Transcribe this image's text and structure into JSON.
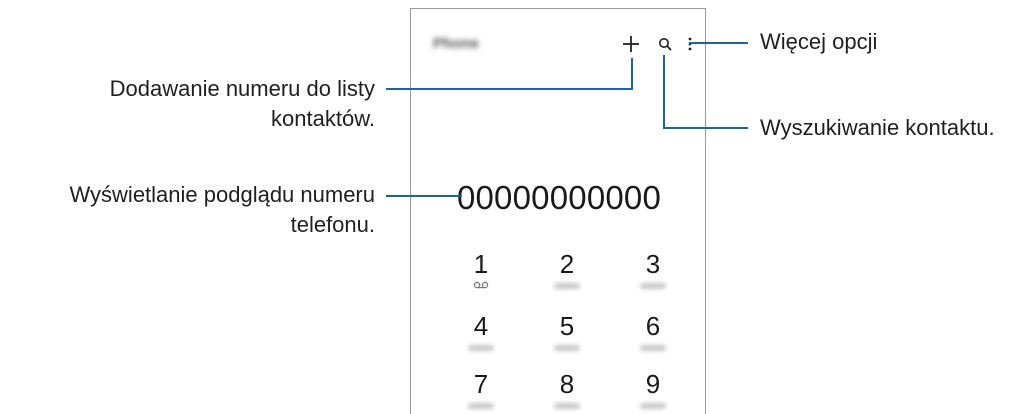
{
  "app": {
    "title": "Phone"
  },
  "dialer": {
    "number": "00000000000",
    "keys": [
      {
        "digit": "1",
        "sub": "voicemail-icon"
      },
      {
        "digit": "2",
        "sub": "ABC"
      },
      {
        "digit": "3",
        "sub": "DEF"
      },
      {
        "digit": "4",
        "sub": "GHI"
      },
      {
        "digit": "5",
        "sub": "JKL"
      },
      {
        "digit": "6",
        "sub": "MNO"
      },
      {
        "digit": "7",
        "sub": "PQRS"
      },
      {
        "digit": "8",
        "sub": "TUV"
      },
      {
        "digit": "9",
        "sub": "WXYZ"
      }
    ]
  },
  "toolbar": {
    "add_icon": "plus-icon",
    "search_icon": "search-icon",
    "more_icon": "more-vertical-icon"
  },
  "callouts": {
    "more_options": "Więcej opcji",
    "add_contact_line1": "Dodawanie numeru do listy",
    "add_contact_line2": "kontaktów.",
    "search_contact": "Wyszukiwanie kontaktu.",
    "preview_line1": "Wyświetlanie podglądu numeru",
    "preview_line2": "telefonu."
  },
  "colors": {
    "callout_line": "#1565a8",
    "frame": "#9a9a9a"
  }
}
